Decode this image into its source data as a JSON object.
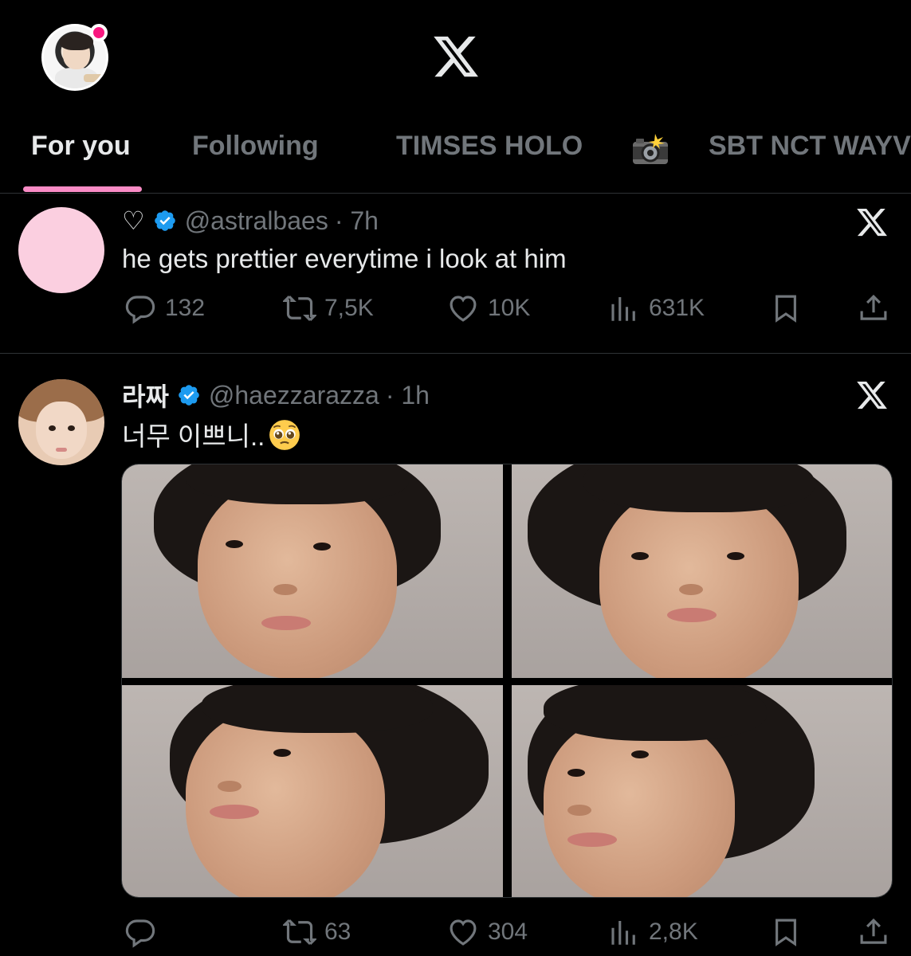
{
  "app": {
    "logo_icon": "x-logo-icon",
    "profile_avatar_icon": "profile-avatar",
    "notification_color": "#f91880"
  },
  "tabs": [
    {
      "label": "For you",
      "active": true
    },
    {
      "label": "Following",
      "active": false
    },
    {
      "label": "TIMSES HOLO",
      "active": false
    },
    {
      "label": "📸",
      "active": false,
      "icon": "camera-flash-icon"
    },
    {
      "label": "SBT NCT WAYV",
      "active": false
    }
  ],
  "accent_color": "#f98bc5",
  "tweets": [
    {
      "display_name": "♡",
      "verified": true,
      "handle": "@astralbaes",
      "time": "· 7h",
      "text": "he gets prettier everytime i look at him",
      "avatar_color": "#fbcfe0",
      "stats": {
        "replies": "132",
        "reposts": "7,5K",
        "likes": "10K",
        "views": "631K"
      }
    },
    {
      "display_name": "라짜",
      "verified": true,
      "handle": "@haezzarazza",
      "time": "· 1h",
      "text": "너무 이쁘니..",
      "emoji": "pleading-face-emoji",
      "media_count": 4,
      "stats": {
        "replies": "",
        "reposts": "63",
        "likes": "304",
        "views": "2,8K"
      }
    }
  ]
}
